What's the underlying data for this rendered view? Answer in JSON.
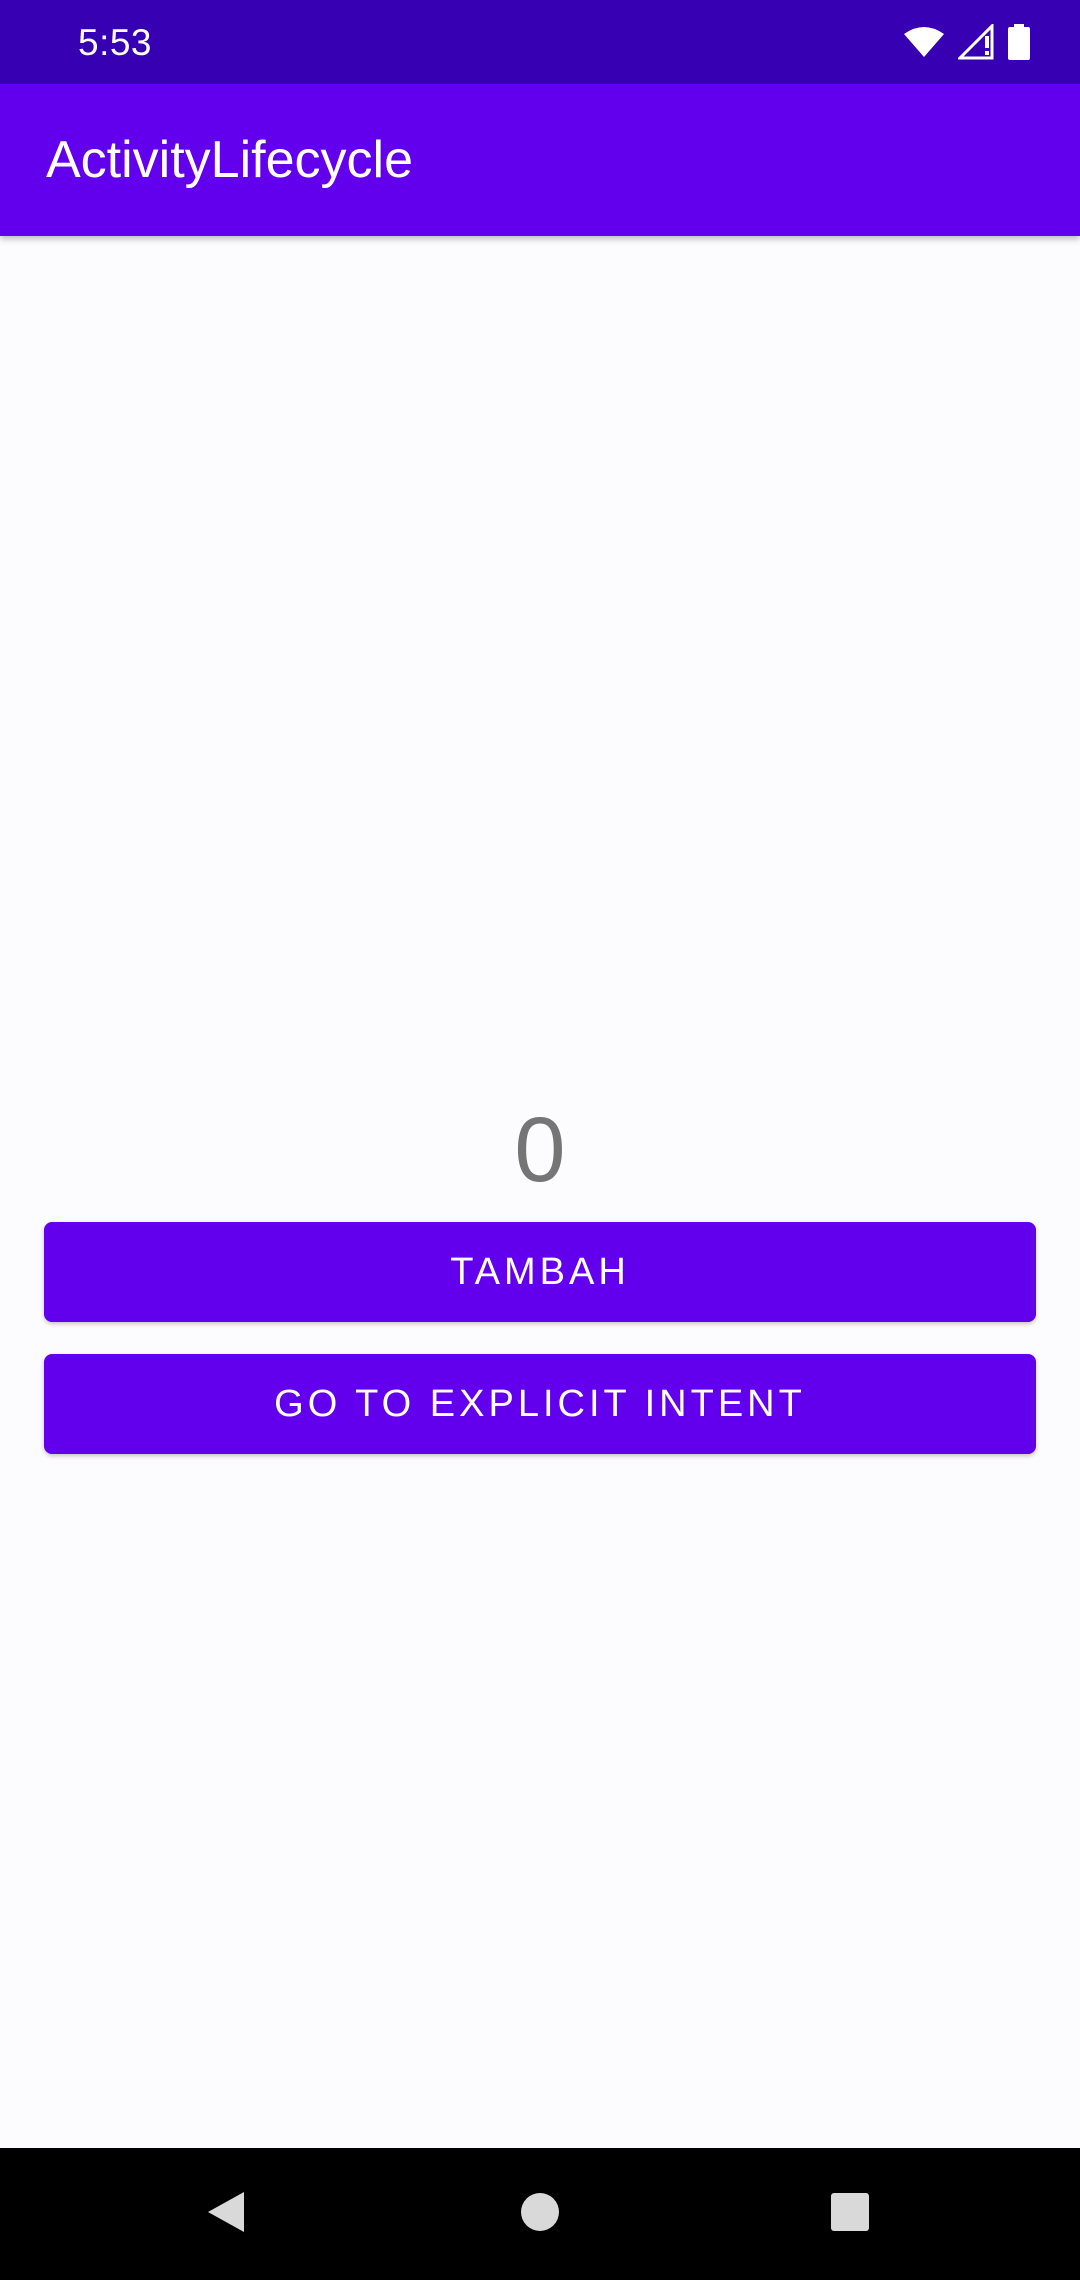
{
  "status_bar": {
    "time": "5:53",
    "icons": [
      "wifi-icon",
      "cell-signal-icon",
      "battery-icon"
    ]
  },
  "app_bar": {
    "title": "ActivityLifecycle"
  },
  "main": {
    "counter_value": "0",
    "tambah_label": "TAMBAH",
    "explicit_intent_label": "GO TO EXPLICIT INTENT"
  },
  "nav_bar": {
    "icons": [
      "back-icon",
      "home-icon",
      "recents-icon"
    ]
  },
  "colors": {
    "status_bar": "#3700b3",
    "primary": "#6200ee",
    "background": "#fcfbfd",
    "counter_text": "#757575"
  }
}
